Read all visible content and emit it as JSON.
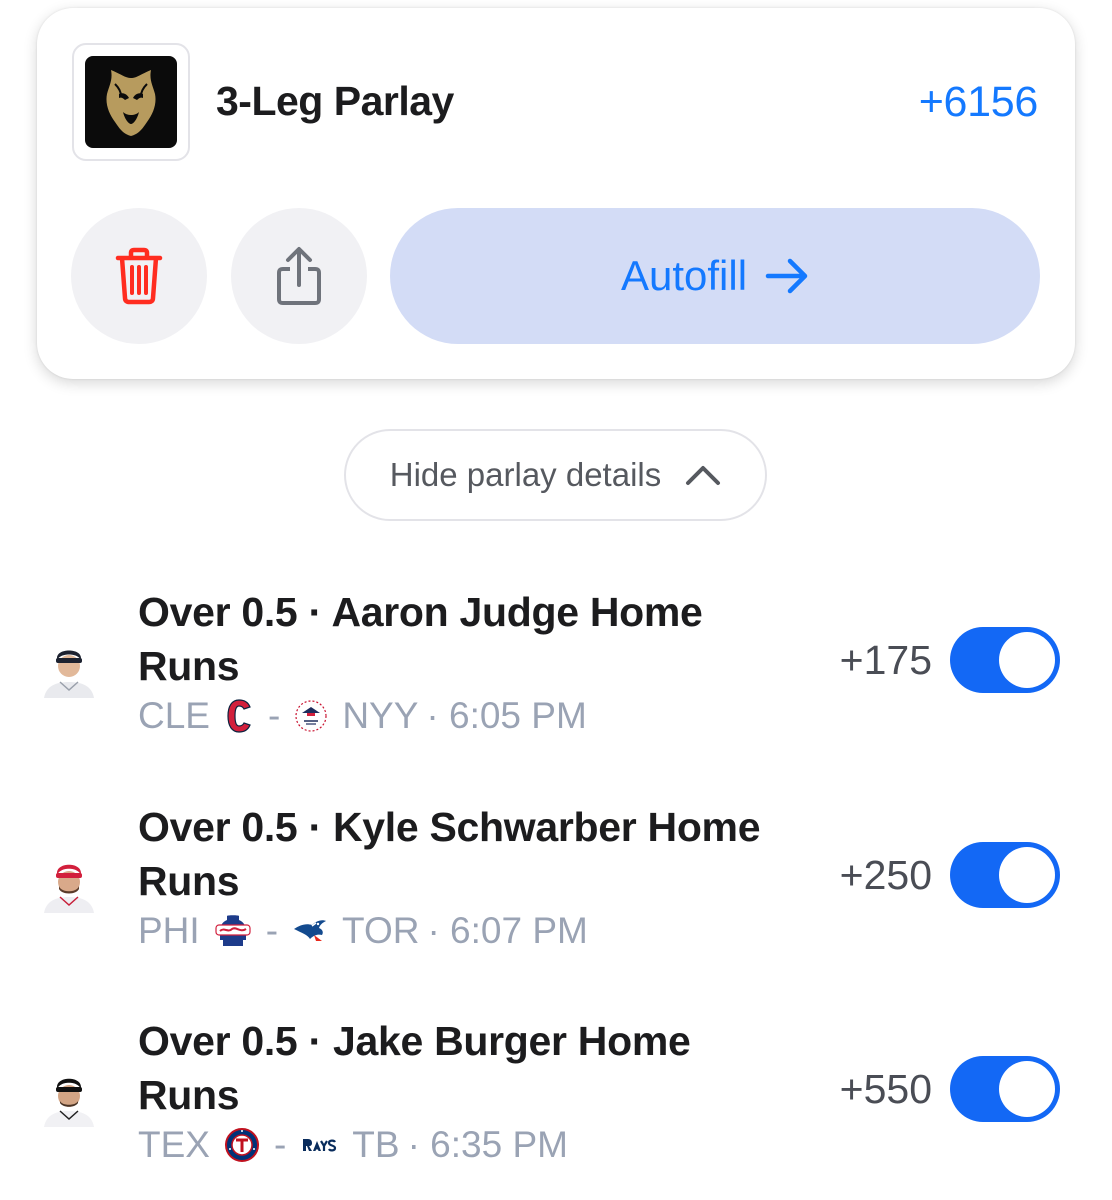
{
  "parlay": {
    "title": "3-Leg Parlay",
    "odds": "+6156",
    "sportsbook_icon": "lion-logo-icon",
    "autofill_label": "Autofill",
    "hide_details_label": "Hide parlay details"
  },
  "colors": {
    "accent": "#1479ff",
    "toggle_on": "#1368f5",
    "autofill_bg": "#d3dcf6",
    "delete_red": "#ff2d20",
    "meta_gray": "#9aa3b4"
  },
  "legs": [
    {
      "title": "Over 0.5 · Aaron Judge Home Runs",
      "odds": "+175",
      "away": "CLE",
      "home": "NYY",
      "time": "· 6:05 PM",
      "sep": "-",
      "enabled": true
    },
    {
      "title": "Over 0.5 · Kyle Schwarber Home Runs",
      "odds": "+250",
      "away": "PHI",
      "home": "TOR",
      "time": "· 6:07 PM",
      "sep": "-",
      "enabled": true
    },
    {
      "title": "Over 0.5 · Jake Burger Home Runs",
      "odds": "+550",
      "away": "TEX",
      "home": "TB",
      "time": "· 6:35 PM",
      "sep": "-",
      "enabled": true
    }
  ]
}
